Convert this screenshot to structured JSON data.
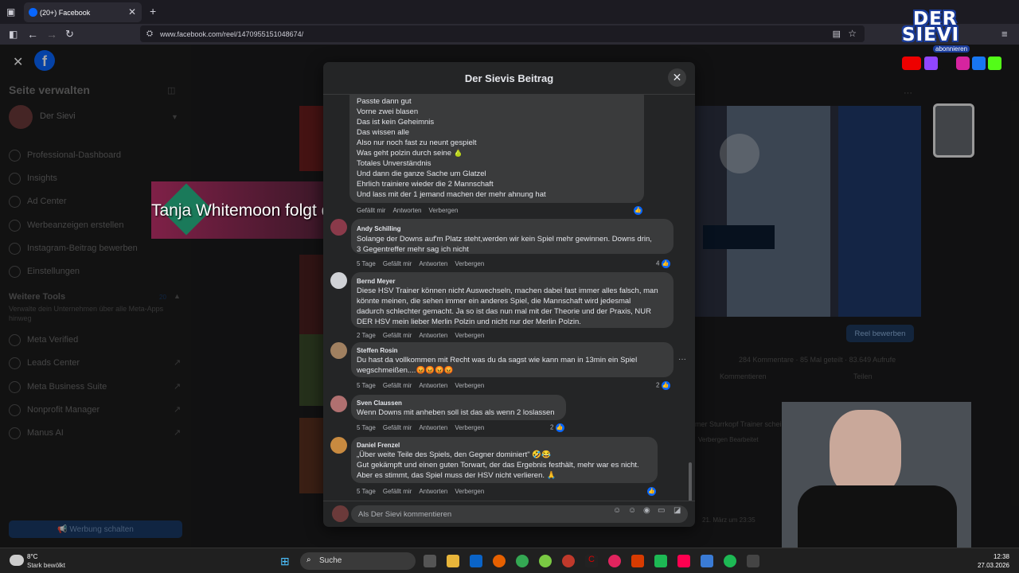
{
  "browser": {
    "tab_title": "(20+) Facebook",
    "url": "www.facebook.com/reel/1470955151048674/"
  },
  "sidebar": {
    "title": "Seite verwalten",
    "page_name": "Der Sievi",
    "items": [
      "Professional-Dashboard",
      "Insights",
      "Ad Center",
      "Werbeanzeigen erstellen",
      "Instagram-Beitrag bewerben",
      "Einstellungen"
    ],
    "tools_title": "Weitere Tools",
    "tools_count": "20",
    "tools_desc": "Verwalte dein Unternehmen über alle Meta-Apps hinweg",
    "tools": [
      "Meta Verified",
      "Leads Center",
      "Meta Business Suite",
      "Nonprofit Manager",
      "Manus AI"
    ],
    "promote_button": "Werbung schalten"
  },
  "overlay": {
    "follow_text": "Tanja Whitemoon folgt dem Sievi"
  },
  "modal": {
    "title": "Der Sievis Beitrag",
    "first_comment_lines": "Passte dann gut\nVorne zwei blasen\nDas ist kein Geheimnis\nDas wissen alle\nAlso nur noch fast zu neunt gespielt\nWas geht polzin durch seine 🍐\nTotales Unverständnis\nUnd dann die ganze Sache um Glatzel\nEhrlich trainiere wieder die 2 Mannschaft\nUnd lass mit der 1 jemand machen der mehr ahnung hat",
    "first_meta": {
      "like": "Gefällt mir",
      "reply": "Antworten",
      "hide": "Verbergen"
    },
    "comments": [
      {
        "author": "Andy Schilling",
        "text": "Solange der Downs auf'm Platz steht,werden wir kein Spiel mehr gewinnen. Downs drin,\n3 Gegentreffer mehr sag ich nicht",
        "time": "5 Tage",
        "reactions": "4"
      },
      {
        "author": "Bernd Meyer",
        "text": "Diese HSV Trainer können nicht Auswechseln, machen dabei fast immer alles falsch, man\nkönnte meinen, die sehen immer ein anderes Spiel, die Mannschaft wird jedesmal\ndadurch schlechter gemacht. Ja so ist das nun mal mit der Theorie und der Praxis, NUR\nDER HSV mein lieber Merlin Polzin und nicht nur der Merlin Polzin.",
        "time": "2 Tage",
        "reactions": ""
      },
      {
        "author": "Steffen Rosin",
        "text": "Du hast da vollkommen mit Recht was du da sagst wie kann man in 13min ein Spiel\nwegschmeißen....😡😡😡😡",
        "time": "5 Tage",
        "reactions": "2"
      },
      {
        "author": "Sven Claussen",
        "text": "Wenn Downs mit anheben soll ist das als wenn 2 loslassen",
        "time": "5 Tage",
        "reactions": "2"
      },
      {
        "author": "Daniel Frenzel",
        "text": "„Über weite Teile des Spiels, den Gegner dominiert\" 🤣😂\nGut gekämpft und einen guten Torwart, der das Ergebnis festhält, mehr war es nicht.\nAber es stimmt, das Spiel muss der HSV nicht verlieren. 🙏",
        "time": "5 Tage",
        "reactions": ""
      }
    ],
    "labels": {
      "like": "Gefällt mir",
      "reply": "Antworten",
      "hide": "Verbergen"
    },
    "composer_placeholder": "Als Der Sievi kommentieren"
  },
  "right_panel": {
    "reel_button": "Reel bewerben",
    "stats": "284 Kommentare · 85 Mal geteilt · 83.649 Aufrufe",
    "comment_action": "Kommentieren",
    "share_action": "Teilen",
    "snippet": "mer Sturrkopf Trainer scheinbar nicht.",
    "snippet_meta": "Verbergen   Bearbeitet",
    "date_text": "21. März um 23:35"
  },
  "logo": {
    "line1": "DER",
    "line2": "SIEVI",
    "subscribe": "abonnieren"
  },
  "taskbar": {
    "temperature": "8°C",
    "weather": "Stark bewölkt",
    "search_label": "Suche",
    "time": "12:38",
    "date": "27.03.2026"
  },
  "colors": {
    "accent": "#0866ff",
    "modal_bg": "#242526",
    "bubble_bg": "#3a3b3c"
  }
}
